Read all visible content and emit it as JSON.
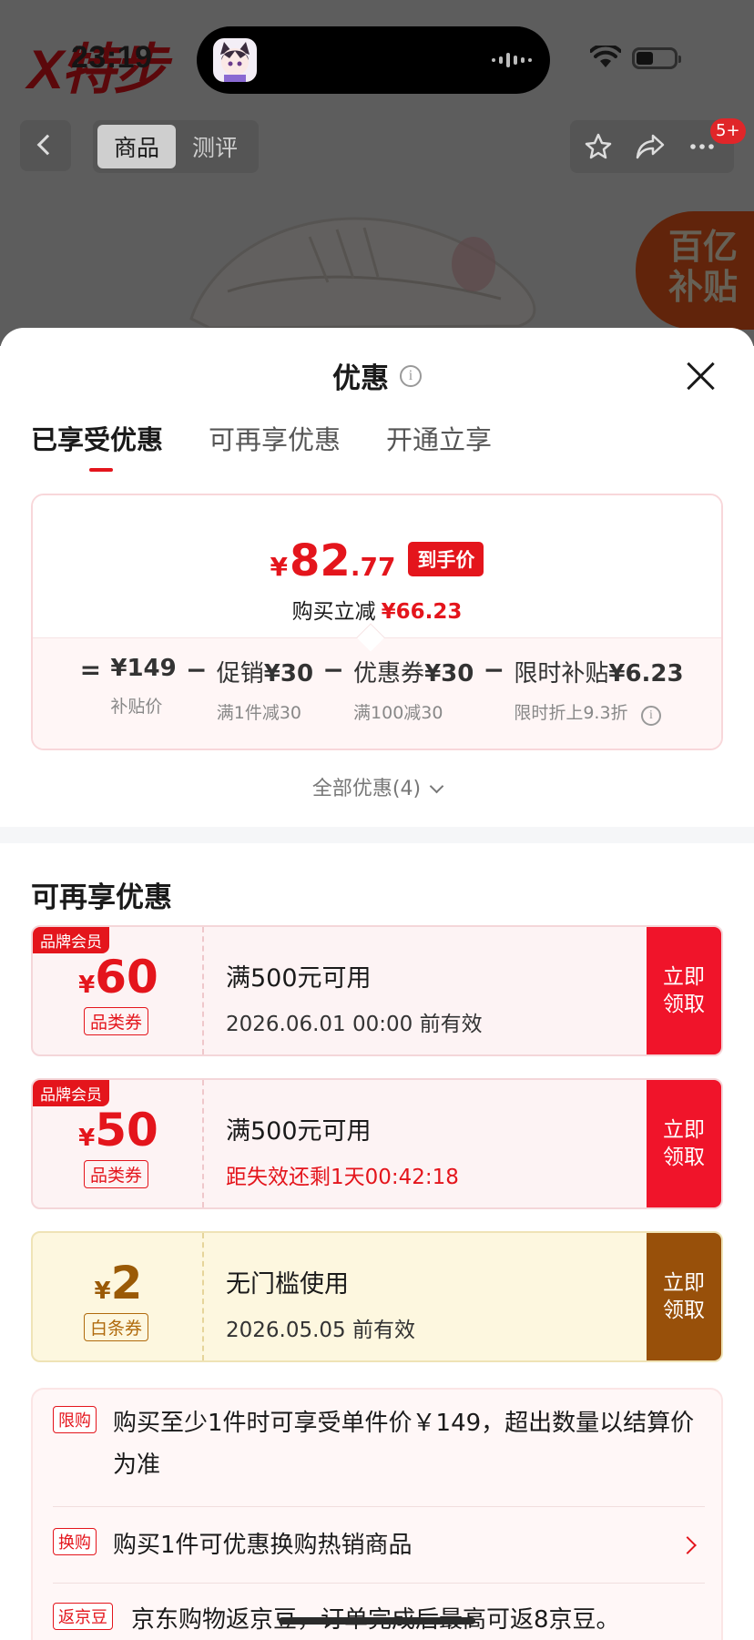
{
  "status_bar": {
    "time": "23:19"
  },
  "product_nav": {
    "tabs": [
      "商品",
      "测评"
    ],
    "badge": "5+",
    "subsidy_label": [
      "百亿",
      "补贴"
    ]
  },
  "sheet": {
    "title": "优惠",
    "tabs": [
      {
        "label": "已享受优惠",
        "active": true
      },
      {
        "label": "可再享优惠",
        "active": false
      },
      {
        "label": "开通立享",
        "active": false
      }
    ],
    "price": {
      "currency": "¥",
      "integer": "82",
      "decimal": ".77",
      "tag": "到手价",
      "save_label": "购买立减",
      "save_value": "¥66.23"
    },
    "breakdown": [
      {
        "op": "=",
        "label": "",
        "amount": "¥149",
        "sub": "补贴价"
      },
      {
        "op": "−",
        "label": "促销",
        "amount": "¥30",
        "sub": "满1件减30"
      },
      {
        "op": "−",
        "label": "优惠券",
        "amount": "¥30",
        "sub": "满100减30"
      },
      {
        "op": "−",
        "label": "限时补贴",
        "amount": "¥6.23",
        "sub": "限时折上9.3折"
      }
    ],
    "all_link": "全部优惠(4)",
    "section_title": "可再享优惠",
    "coupons": [
      {
        "brand": "品牌会员",
        "currency": "¥",
        "value": "60",
        "type": "品类券",
        "condition": "满500元可用",
        "expiry": "2026.06.01 00:00 前有效",
        "expiry_red": false,
        "button": "立即领取",
        "style": "red"
      },
      {
        "brand": "品牌会员",
        "currency": "¥",
        "value": "50",
        "type": "品类券",
        "condition": "满500元可用",
        "expiry": "距失效还剩1天00:42:18",
        "expiry_red": true,
        "button": "立即领取",
        "style": "red"
      },
      {
        "brand": "",
        "currency": "¥",
        "value": "2",
        "type": "白条券",
        "condition": "无门槛使用",
        "expiry": "2026.05.05 前有效",
        "expiry_red": false,
        "button": "立即领取",
        "style": "yellow"
      }
    ],
    "info_rows": [
      {
        "tag": "限购",
        "text": "购买至少1件时可享受单件价￥149，超出数量以结算价为准"
      },
      {
        "tag": "换购",
        "text": "购买1件可优惠换购热销商品"
      },
      {
        "tag": "返京豆",
        "text": "京东购物返京豆，订单完成后最高可返8京豆。"
      }
    ]
  }
}
